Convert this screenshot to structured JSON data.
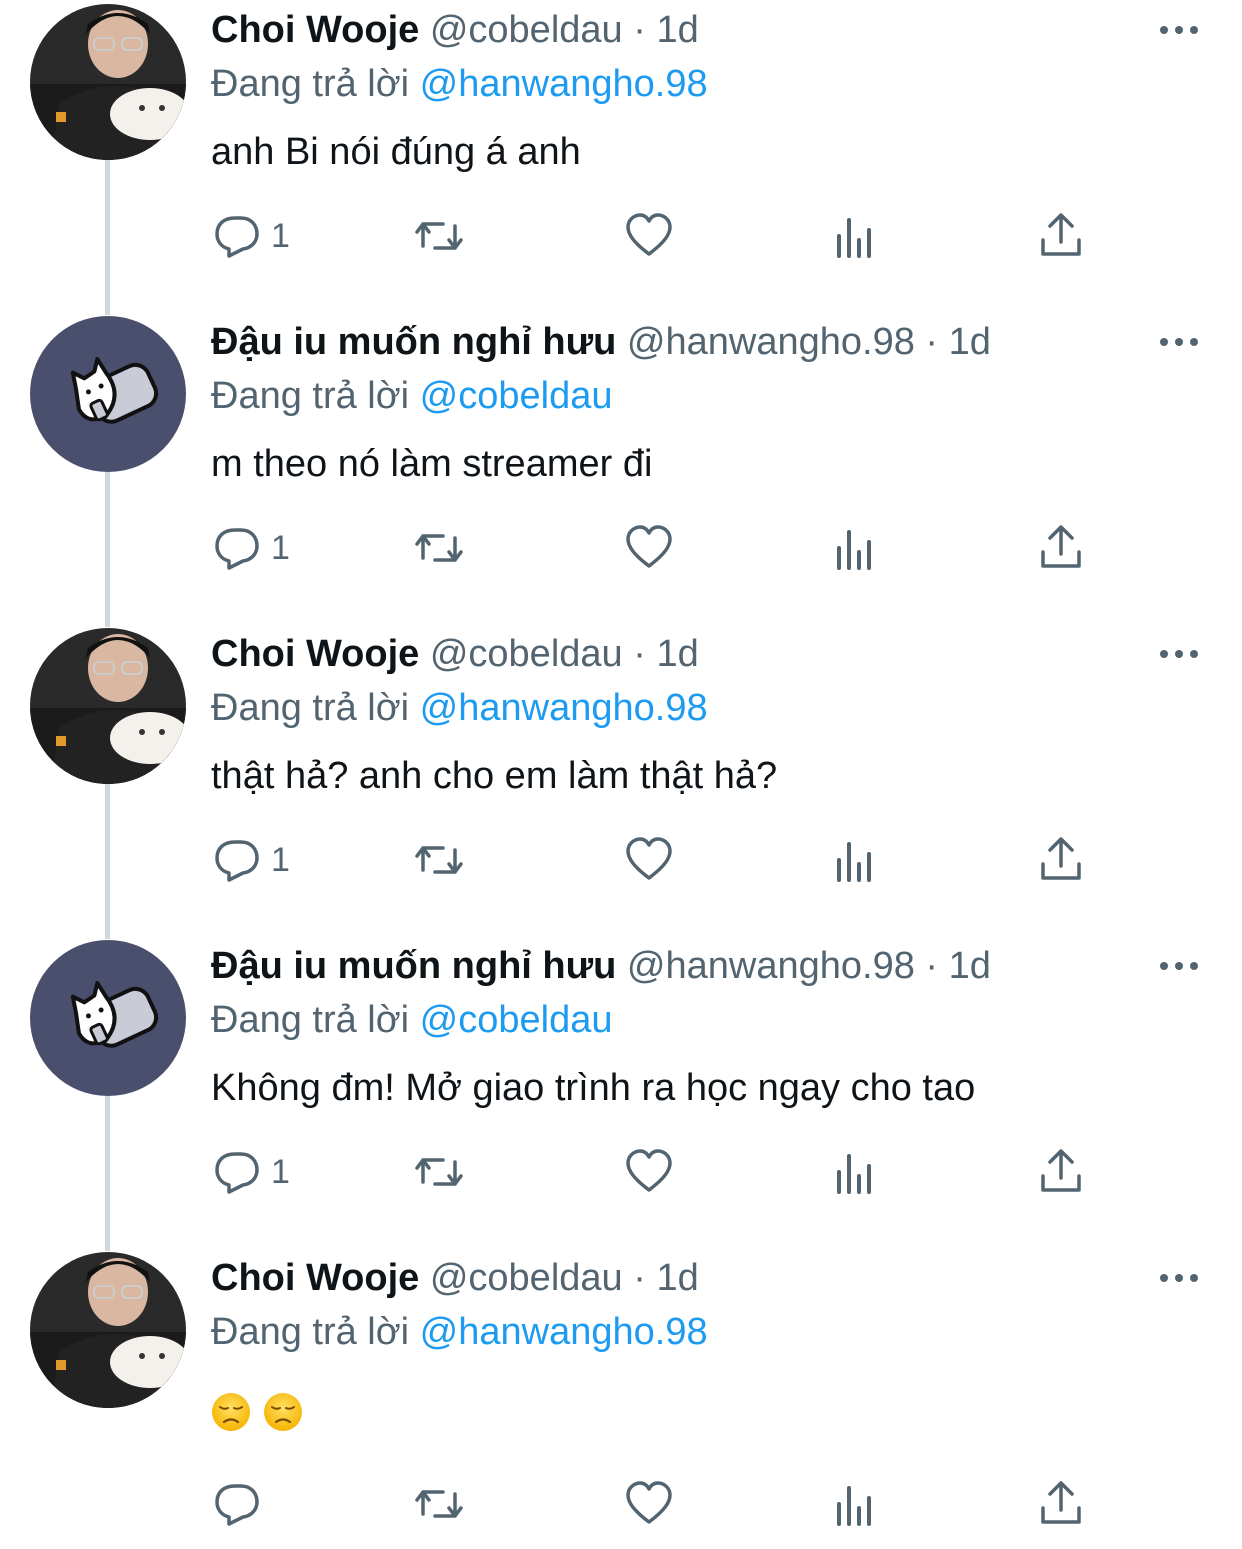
{
  "tweets": [
    {
      "avatar": "person-avatar",
      "name": "Choi Wooje",
      "handle": "@cobeldau",
      "sep": "·",
      "time": "1d",
      "replying_prefix": "Đang trả lời",
      "replying_to": "@hanwangho.98",
      "text": "anh Bi nói đúng á anh",
      "reply_count": "1"
    },
    {
      "avatar": "cat-avatar",
      "name": "Đậu iu muốn nghỉ hưu",
      "handle": "@hanwangho.98",
      "sep": "·",
      "time": "1d",
      "replying_prefix": "Đang trả lời",
      "replying_to": "@cobeldau",
      "text": "m theo nó làm streamer đi",
      "reply_count": "1"
    },
    {
      "avatar": "person-avatar",
      "name": "Choi Wooje",
      "handle": "@cobeldau",
      "sep": "·",
      "time": "1d",
      "replying_prefix": "Đang trả lời",
      "replying_to": "@hanwangho.98",
      "text": "thật hả? anh cho em làm thật hả?",
      "reply_count": "1"
    },
    {
      "avatar": "cat-avatar",
      "name": "Đậu iu muốn nghỉ hưu",
      "handle": "@hanwangho.98",
      "sep": "·",
      "time": "1d",
      "replying_prefix": "Đang trả lời",
      "replying_to": "@cobeldau",
      "text": "Không đm! Mở giao trình ra học ngay cho tao",
      "reply_count": "1"
    },
    {
      "avatar": "person-avatar",
      "name": "Choi Wooje",
      "handle": "@cobeldau",
      "sep": "·",
      "time": "1d",
      "replying_prefix": "Đang trả lời",
      "replying_to": "@hanwangho.98",
      "emojis": [
        "disappointed-face-emoji",
        "disappointed-face-emoji"
      ],
      "reply_count": ""
    }
  ],
  "colors": {
    "text": "#0f1419",
    "secondary": "#536471",
    "link": "#1d9bf0",
    "thread_line": "#cfd9de",
    "cat_avatar_bg": "#4b4f6e"
  },
  "icons": [
    "reply-icon",
    "retweet-icon",
    "like-icon",
    "views-icon",
    "share-icon",
    "more-icon"
  ]
}
